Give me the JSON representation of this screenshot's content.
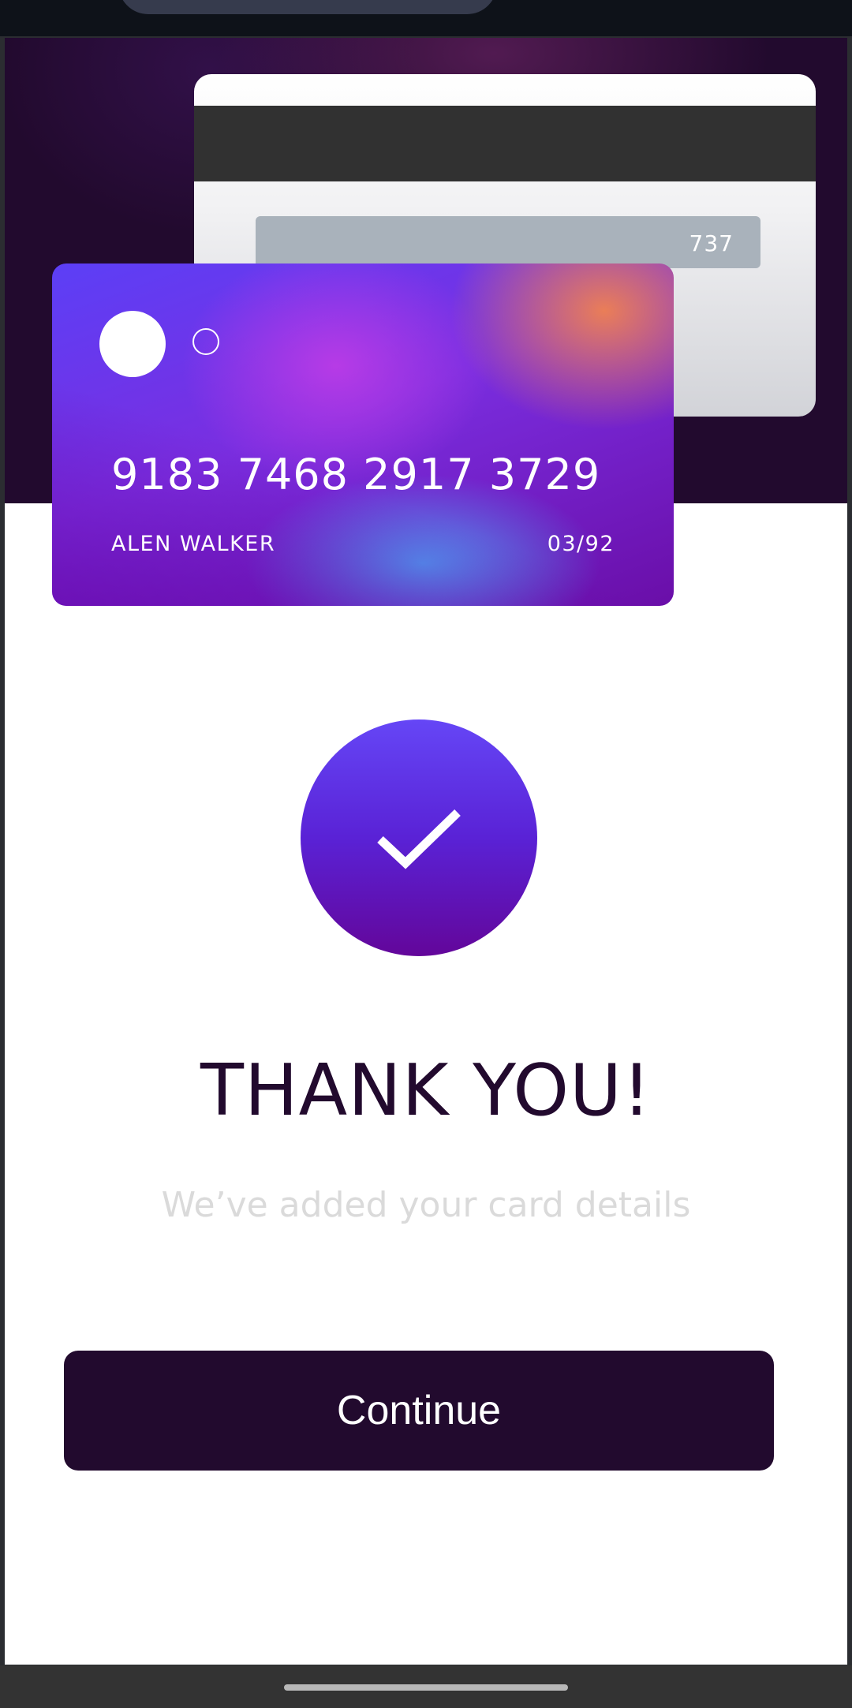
{
  "card_back": {
    "cvv": "737"
  },
  "card_front": {
    "number": "9183 7468 2917 3729",
    "holder_name": "ALEN WALKER",
    "expiry": "03/92"
  },
  "success": {
    "icon": "checkmark-icon",
    "title": "THANK YOU!",
    "subtitle": "We’ve added your card details"
  },
  "actions": {
    "continue_label": "Continue"
  },
  "colors": {
    "dark_violet": "#220a2e",
    "accent_start": "#6546f6",
    "accent_end": "#63069a",
    "subtitle_gray": "#dadada"
  }
}
